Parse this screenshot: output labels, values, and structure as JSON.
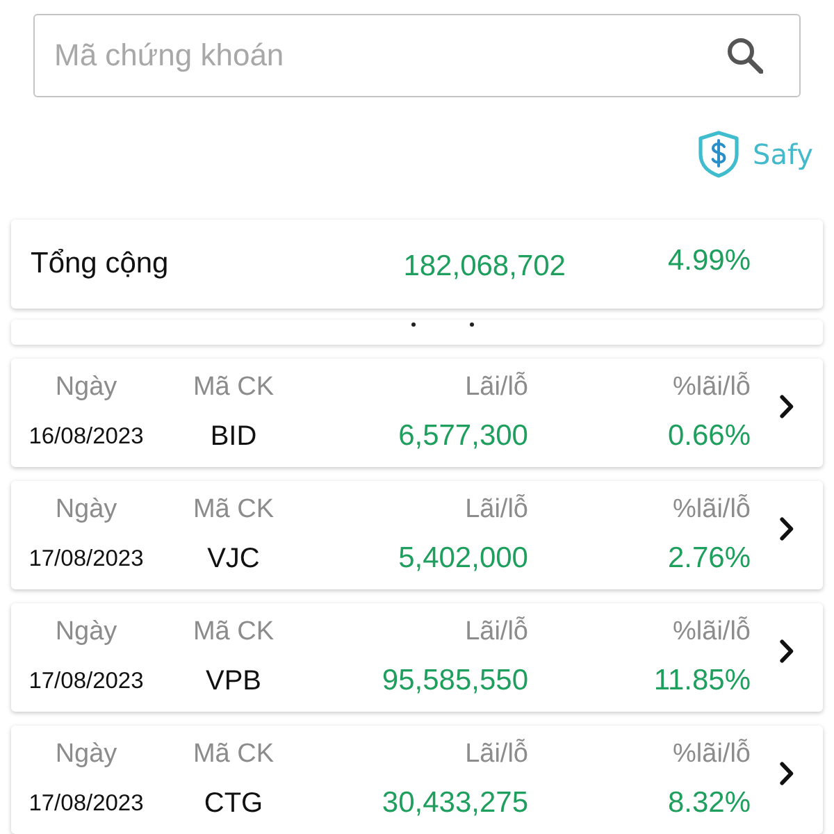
{
  "search": {
    "placeholder": "Mã chứng khoán"
  },
  "brand": {
    "label": "Safy"
  },
  "total": {
    "label": "Tổng cộng",
    "profit": "182,068,702",
    "percent": "4.99%"
  },
  "trades": [
    {
      "date_label": "Ngày",
      "symbol_label": "Mã CK",
      "profit_label": "Lãi/lỗ",
      "percent_label": "%lãi/lỗ",
      "date": "16/08/2023",
      "symbol": "BID",
      "profit": "6,577,300",
      "percent": "0.66%"
    },
    {
      "date_label": "Ngày",
      "symbol_label": "Mã CK",
      "profit_label": "Lãi/lỗ",
      "percent_label": "%lãi/lỗ",
      "date": "17/08/2023",
      "symbol": "VJC",
      "profit": "5,402,000",
      "percent": "2.76%"
    },
    {
      "date_label": "Ngày",
      "symbol_label": "Mã CK",
      "profit_label": "Lãi/lỗ",
      "percent_label": "%lãi/lỗ",
      "date": "17/08/2023",
      "symbol": "VPB",
      "profit": "95,585,550",
      "percent": "11.85%"
    },
    {
      "date_label": "Ngày",
      "symbol_label": "Mã CK",
      "profit_label": "Lãi/lỗ",
      "percent_label": "%lãi/lỗ",
      "date": "17/08/2023",
      "symbol": "CTG",
      "profit": "30,433,275",
      "percent": "8.32%"
    }
  ]
}
